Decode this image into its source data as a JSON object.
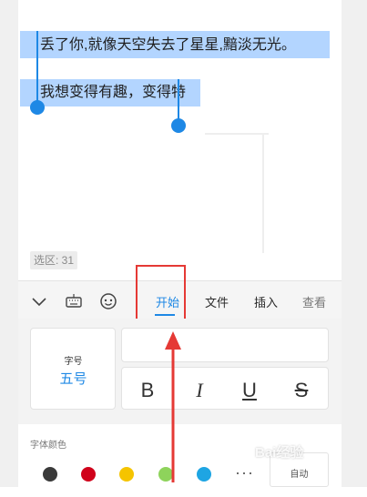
{
  "document": {
    "line1": "丢了你,就像天空失去了星星,黯淡无光。",
    "line2": "我想变得有趣，变得特"
  },
  "status": {
    "selection_count": "选区: 31"
  },
  "toolbar": {
    "icons": [
      "collapse-chevron-icon",
      "keyboard-icon",
      "emoji-icon"
    ],
    "tabs": [
      {
        "label": "开始",
        "active": true
      },
      {
        "label": "文件",
        "active": false
      },
      {
        "label": "插入",
        "active": false
      },
      {
        "label": "查看",
        "active": false
      }
    ]
  },
  "font_panel": {
    "size_label": "字号",
    "size_value": "五号",
    "format_buttons": [
      "B",
      "I",
      "U",
      "S"
    ]
  },
  "color_panel": {
    "label": "字体颜色",
    "swatches": [
      "#3a3a3a",
      "#d0021b",
      "#f5c400",
      "#8ed35b",
      "#1ea5e3"
    ],
    "more": "···",
    "auto_label": "自动"
  },
  "colors": {
    "accent": "#1e88e5",
    "annotation": "#e53935",
    "selection": "#b3d5ff"
  },
  "watermark": "Bai经验"
}
